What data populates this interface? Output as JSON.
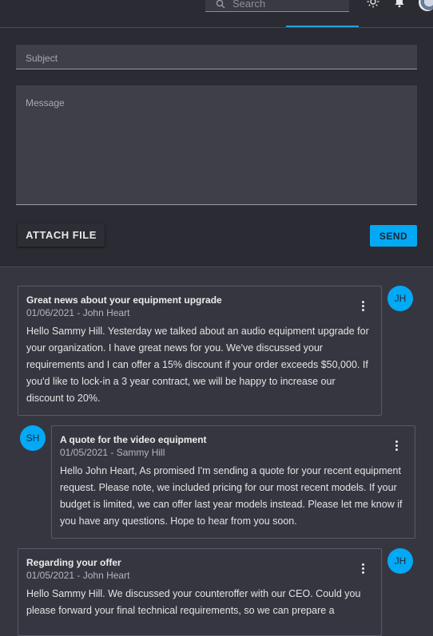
{
  "header": {
    "search_placeholder": "Search",
    "icons": [
      "search-icon",
      "theme-sun-icon",
      "notification-bell-icon",
      "user-avatar"
    ],
    "accent": "#1fa3e0"
  },
  "compose": {
    "subject_placeholder": "Subject",
    "message_placeholder": "Message",
    "attach_label": "ATTACH FILE",
    "send_label": "SEND",
    "send_color": "#03a9f4"
  },
  "messages": [
    {
      "title": "Great news about your equipment upgrade",
      "meta": "01/06/2021 - John Heart",
      "initials": "JH",
      "body": "Hello Sammy Hill. Yesterday we talked about an audio equipment upgrade for your organization. I have great news for you. We've discussed your requirements and I can offer a 15% discount if your order exceeds $50,000. If you'd like to lock-in a 3 year contract, we will be happy to increase our discount to 20%."
    },
    {
      "title": "A quote for the video equipment",
      "meta": "01/05/2021 - Sammy Hill",
      "initials": "SH",
      "body": "Hello John Heart, As promised I'm sending a quote for your recent equipment request. Please note, we included pricing for our most recent models. If your budget is limited, we can offer last year models instead. Please let me know if you have any questions. Hope to hear from you soon."
    },
    {
      "title": "Regarding your offer",
      "meta": "01/05/2021 - John Heart",
      "initials": "JH",
      "body": "Hello Sammy Hill. We discussed your counteroffer with our CEO. Could you please forward your final technical requirements, so we can prepare a"
    }
  ]
}
